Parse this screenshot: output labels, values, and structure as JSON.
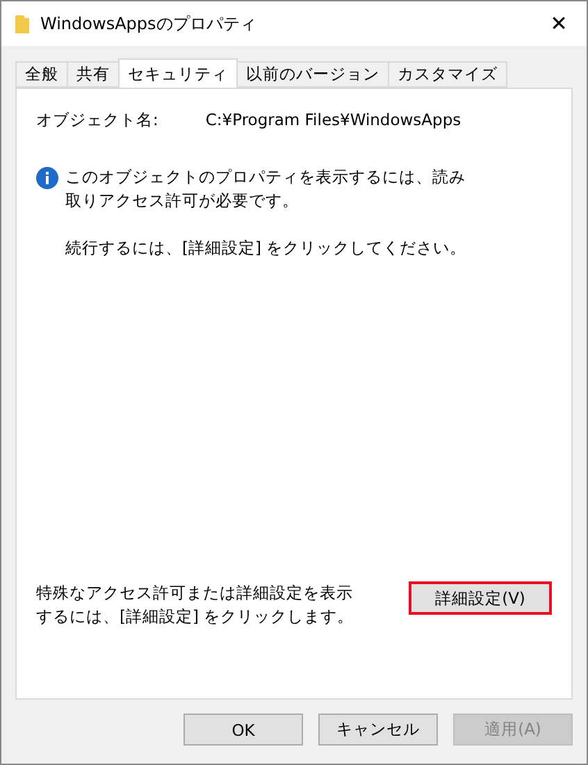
{
  "window": {
    "title": "WindowsAppsのプロパティ",
    "close": "✕"
  },
  "tabs": [
    {
      "label": "全般",
      "selected": false
    },
    {
      "label": "共有",
      "selected": false
    },
    {
      "label": "セキュリティ",
      "selected": true
    },
    {
      "label": "以前のバージョン",
      "selected": false
    },
    {
      "label": "カスタマイズ",
      "selected": false
    }
  ],
  "object": {
    "label": "オブジェクト名:",
    "value": "C:¥Program Files¥WindowsApps"
  },
  "info": {
    "message": "このオブジェクトのプロパティを表示するには、読み取りアクセス許可が必要です。",
    "hint": "続行するには、[詳細設定] をクリックしてください。"
  },
  "advanced": {
    "text": "特殊なアクセス許可または詳細設定を表示するには、[詳細設定] をクリックします。",
    "button": "詳細設定(V)",
    "highlighted": true
  },
  "buttons": [
    {
      "label": "OK",
      "disabled": false
    },
    {
      "label": "キャンセル",
      "disabled": false
    },
    {
      "label": "適用(A)",
      "disabled": true
    }
  ]
}
